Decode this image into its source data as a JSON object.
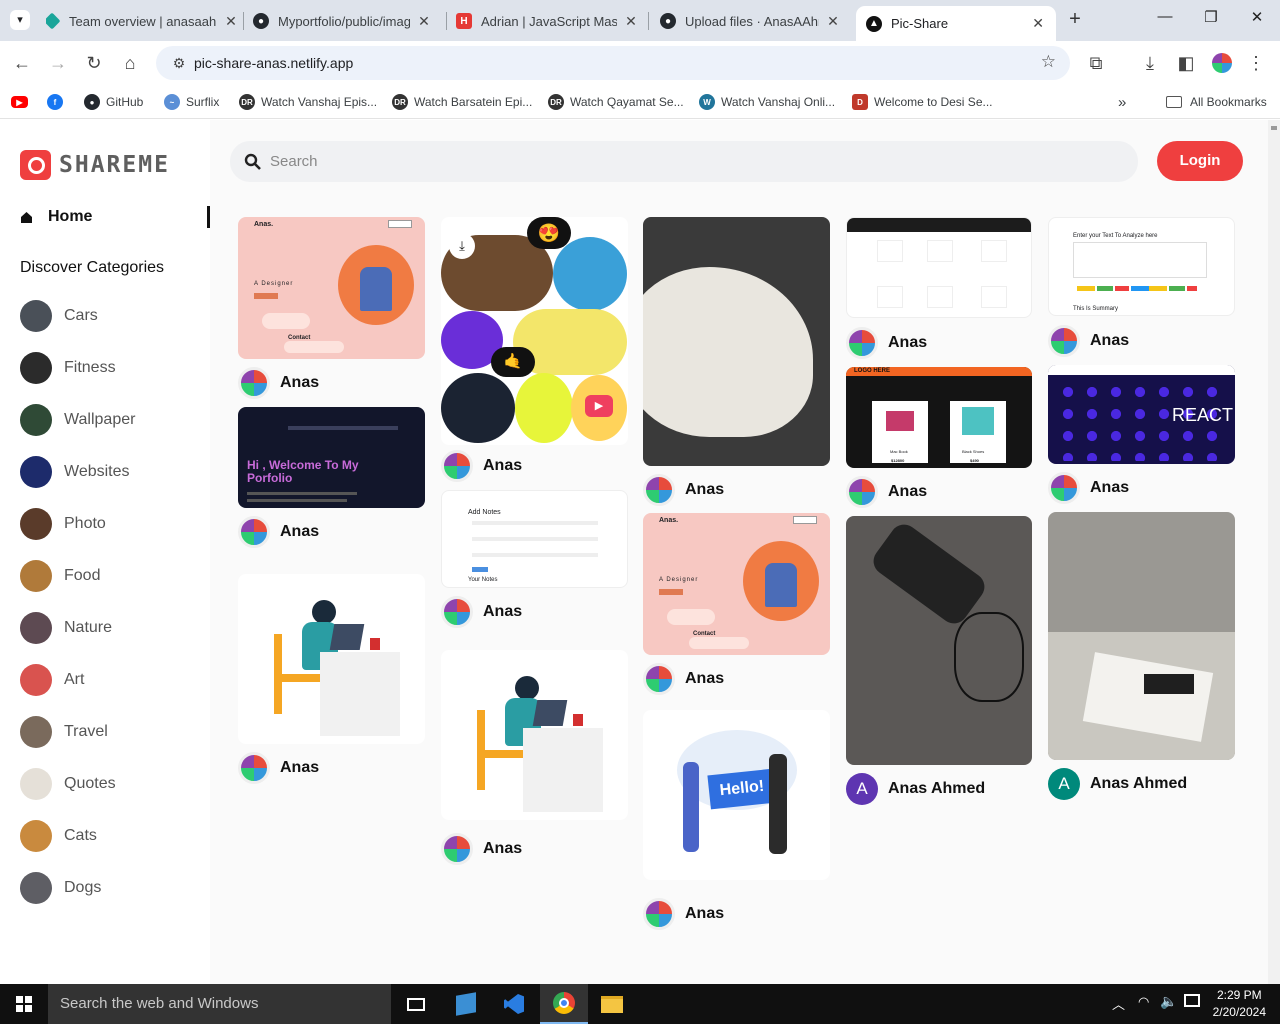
{
  "browser": {
    "tabs": [
      {
        "title": "Team overview | anasaahm",
        "favicon_color": "#1aa59a"
      },
      {
        "title": "Myportfolio/public/image",
        "favicon_color": "#24292f"
      },
      {
        "title": "Adrian | JavaScript Maste",
        "favicon_color": "#e53935"
      },
      {
        "title": "Upload files · AnasAAhme",
        "favicon_color": "#24292f"
      },
      {
        "title": "Pic-Share",
        "favicon_color": "#111111"
      }
    ],
    "close_glyph": "✕",
    "new_tab": "+",
    "url": "pic-share-anas.netlify.app",
    "bookmarks": [
      {
        "label": "",
        "icon": "youtube-icon",
        "color": "#ff0000"
      },
      {
        "label": "",
        "icon": "facebook-icon",
        "color": "#1877f2"
      },
      {
        "label": "GitHub",
        "icon": "github-icon",
        "color": "#24292f"
      },
      {
        "label": "Surflix",
        "icon": "surflix-icon",
        "color": "#5b8fd6"
      },
      {
        "label": "Watch Vanshaj Epis...",
        "icon": "dr-icon",
        "color": "#333333"
      },
      {
        "label": "Watch Barsatein Epi...",
        "icon": "dr-icon",
        "color": "#333333"
      },
      {
        "label": "Watch Qayamat Se...",
        "icon": "dr-icon",
        "color": "#333333"
      },
      {
        "label": "Watch Vanshaj Onli...",
        "icon": "wordpress-icon",
        "color": "#21759b"
      },
      {
        "label": "Welcome to Desi Se...",
        "icon": "desi-icon",
        "color": "#c0392b"
      }
    ],
    "more_bookmarks": "»",
    "all_bookmarks": "All Bookmarks"
  },
  "app": {
    "logo_text": "SHAREME",
    "home": "Home",
    "discover": "Discover Categories",
    "categories": [
      {
        "name": "Cars",
        "color": "#4a5058"
      },
      {
        "name": "Fitness",
        "color": "#2b2b2b"
      },
      {
        "name": "Wallpaper",
        "color": "#2f4a36"
      },
      {
        "name": "Websites",
        "color": "#1d2b6b"
      },
      {
        "name": "Photo",
        "color": "#5a3b2a"
      },
      {
        "name": "Food",
        "color": "#b07a3a"
      },
      {
        "name": "Nature",
        "color": "#5d4a52"
      },
      {
        "name": "Art",
        "color": "#d9534f"
      },
      {
        "name": "Travel",
        "color": "#7a6a5c"
      },
      {
        "name": "Quotes",
        "color": "#e5e0d8"
      },
      {
        "name": "Cats",
        "color": "#c98a3e"
      },
      {
        "name": "Dogs",
        "color": "#5e5e64"
      }
    ],
    "search_placeholder": "Search",
    "login": "Login",
    "pins": [
      {
        "owner": "Anas",
        "desc": "A Designer",
        "heading": "Anas.",
        "sub": "Contact"
      },
      {
        "owner": "Anas",
        "desc": "Hi , Welcome To My Porfolio"
      },
      {
        "owner": "Anas"
      },
      {
        "owner": "Anas"
      },
      {
        "owner": "Anas",
        "heading": "Add Notes",
        "sub": "Your Notes"
      },
      {
        "owner": "Anas"
      },
      {
        "owner": "Anas"
      },
      {
        "owner": "Anas",
        "desc": "A Designer",
        "heading": "Anas.",
        "sub": "Contact"
      },
      {
        "owner": "Anas",
        "desc": "Hello!"
      },
      {
        "owner": "Anas"
      },
      {
        "owner": "Anas",
        "heading": "LOGO HERE",
        "items": [
          "Mac Book",
          "$12800",
          "Black Shoes",
          "$490"
        ]
      },
      {
        "owner": "Anas Ahmed",
        "initial": "A",
        "color": "#5e35b1"
      },
      {
        "owner": "Anas",
        "heading": "Enter your Text To Analyze here",
        "sub": "This Is Summary"
      },
      {
        "owner": "Anas",
        "desc": "REACT"
      },
      {
        "owner": "Anas Ahmed",
        "initial": "A",
        "color": "#00897b"
      }
    ]
  },
  "taskbar": {
    "search": "Search the web and Windows",
    "time": "2:29 PM",
    "date": "2/20/2024"
  }
}
